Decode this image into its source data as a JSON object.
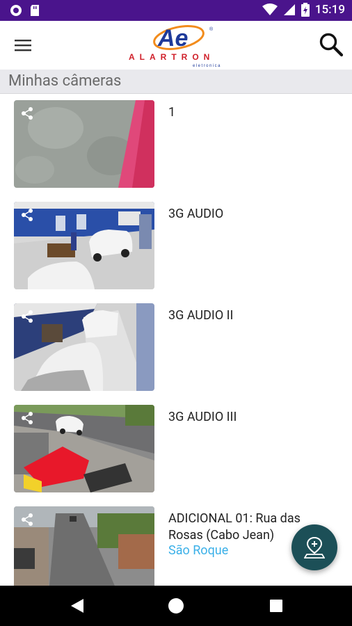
{
  "status_bar": {
    "time": "15:19",
    "icons": [
      "notification-icon",
      "sd-card-icon",
      "wifi-icon",
      "signal-icon",
      "battery-icon"
    ]
  },
  "app_bar": {
    "logo_text": "ALARTRON",
    "logo_monogram": "Ae",
    "logo_subtext": "eletronica",
    "menu_icon": "hamburger-menu-icon",
    "search_icon": "search-icon"
  },
  "section": {
    "title": "Minhas câmeras"
  },
  "cameras": [
    {
      "name": "1",
      "location": ""
    },
    {
      "name": "3G AUDIO",
      "location": ""
    },
    {
      "name": "3G AUDIO II",
      "location": ""
    },
    {
      "name": "3G AUDIO III",
      "location": ""
    },
    {
      "name": "ADICIONAL 01: Rua das Rosas (Cabo Jean)",
      "location": "São Roque"
    }
  ],
  "fab": {
    "icon": "map-pin-icon"
  },
  "nav_bar": {
    "icons": [
      "back-icon",
      "home-icon",
      "recents-icon"
    ]
  },
  "colors": {
    "status_bar": "#4a148c",
    "fab": "#1c4f57",
    "location_text": "#3bb0e8",
    "section_bg": "#e9e9ed"
  }
}
